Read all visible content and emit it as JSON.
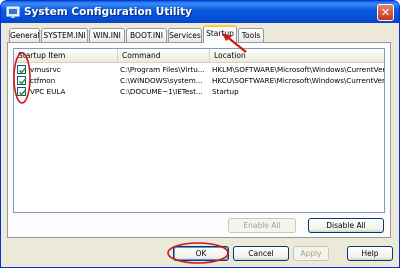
{
  "window": {
    "title": "System Configuration Utility"
  },
  "tabs": [
    {
      "label": "General"
    },
    {
      "label": "SYSTEM.INI"
    },
    {
      "label": "WIN.INI"
    },
    {
      "label": "BOOT.INI"
    },
    {
      "label": "Services"
    },
    {
      "label": "Startup",
      "active": true
    },
    {
      "label": "Tools"
    }
  ],
  "list": {
    "columns": [
      "Startup Item",
      "Command",
      "Location"
    ],
    "rows": [
      {
        "checked": true,
        "item": "vmusrvc",
        "command": "C:\\Program Files\\Virtu...",
        "location": "HKLM\\SOFTWARE\\Microsoft\\Windows\\CurrentVer..."
      },
      {
        "checked": true,
        "item": "ctfmon",
        "command": "C:\\WINDOWS\\system...",
        "location": "HKCU\\SOFTWARE\\Microsoft\\Windows\\CurrentVer..."
      },
      {
        "checked": true,
        "item": "VPC EULA",
        "command": "C:\\DOCUME~1\\IETest...",
        "location": "Startup"
      }
    ]
  },
  "buttons": {
    "enable_all": "Enable All",
    "disable_all": "Disable All",
    "ok": "OK",
    "cancel": "Cancel",
    "apply": "Apply",
    "help": "Help"
  },
  "colors": {
    "annotation": "#cc1b1b",
    "titlebar": "#0a5ae0",
    "tab_highlight": "#ffc83c"
  }
}
